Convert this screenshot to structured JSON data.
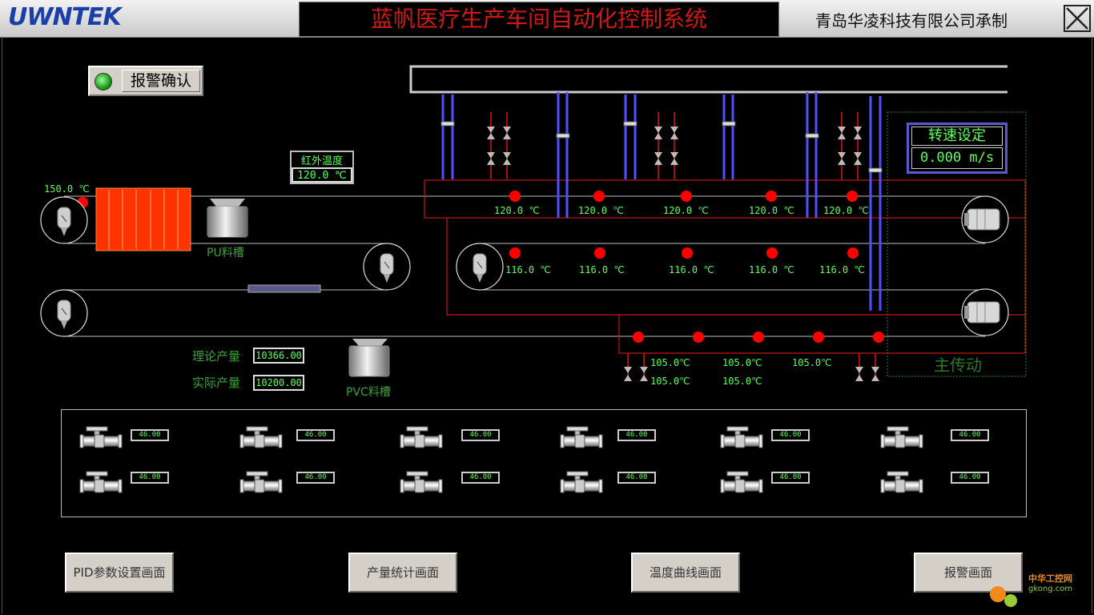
{
  "header": {
    "logo": "UWNTEK",
    "title": "蓝帆医疗生产车间自动化控制系统",
    "company": "青岛华凌科技有限公司承制"
  },
  "alarm_ack": {
    "label": "报警确认",
    "led_color": "#22b322"
  },
  "infrared": {
    "label": "红外温度",
    "value": "120.0 ℃"
  },
  "speed": {
    "label": "转速设定",
    "value": "0.000 m/s"
  },
  "left_temp": "150.0 ℃",
  "temps_row1": [
    "120.0 ℃",
    "120.0 ℃",
    "120.0 ℃",
    "120.0 ℃",
    "120.0 ℃"
  ],
  "temps_row2": [
    "116.0 ℃",
    "116.0 ℃",
    "116.0 ℃",
    "116.0 ℃",
    "116.0 ℃"
  ],
  "temps_row3": [
    "105.0℃",
    "105.0℃",
    "105.0℃",
    "105.0℃",
    "105.0℃"
  ],
  "tanks": {
    "pu": "PU料槽",
    "pvc": "PVC料槽"
  },
  "production": {
    "theory_label": "理论产量",
    "theory_value": "10366.00",
    "actual_label": "实际产量",
    "actual_value": "10200.00"
  },
  "main_drive": "主传动",
  "valves": [
    "46.00",
    "46.00",
    "46.00",
    "46.00",
    "46.00",
    "46.00",
    "46.00",
    "46.00",
    "46.00",
    "46.00",
    "46.00",
    "46.00"
  ],
  "nav": {
    "pid": "PID参数设置画面",
    "output": "产量统计画面",
    "temp_curve": "温度曲线画面",
    "alarm": "报警画面"
  },
  "watermark": {
    "line1": "中华工控网",
    "line2": "gkong.com"
  },
  "colors": {
    "title_red": "#d01818",
    "value_green": "#5dff5d",
    "pipe_blue": "#5050ff",
    "sensor_red": "#ff0000"
  }
}
